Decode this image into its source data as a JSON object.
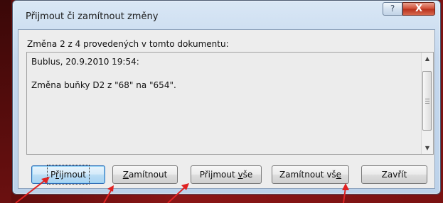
{
  "dialog": {
    "title": "Přijmout či zamítnout změny",
    "help_glyph": "?",
    "close_glyph": "X"
  },
  "summary": "Změna 2 z 4 provedených v tomto dokumentu:",
  "change": {
    "author_time": "Bublus, 20.9.2010 19:54:",
    "description": "Změna buňky D2 z \"68\" na \"654\"."
  },
  "scrollbar": {
    "up_icon": "▲",
    "down_icon": "▼"
  },
  "buttons": {
    "accept_pre": "P",
    "accept_underlined": "ř",
    "accept_post": "ijmout",
    "reject_pre": "",
    "reject_underlined": "Z",
    "reject_post": "amítnout",
    "accept_all_pre": "Přijmout ",
    "accept_all_underlined": "v",
    "accept_all_post": "še",
    "reject_all_pre": "Zamítnout vš",
    "reject_all_underlined": "e",
    "reject_all_post": "",
    "close": "Zavřít"
  },
  "colors": {
    "background": "#7a1212",
    "arrow": "#e02222"
  }
}
